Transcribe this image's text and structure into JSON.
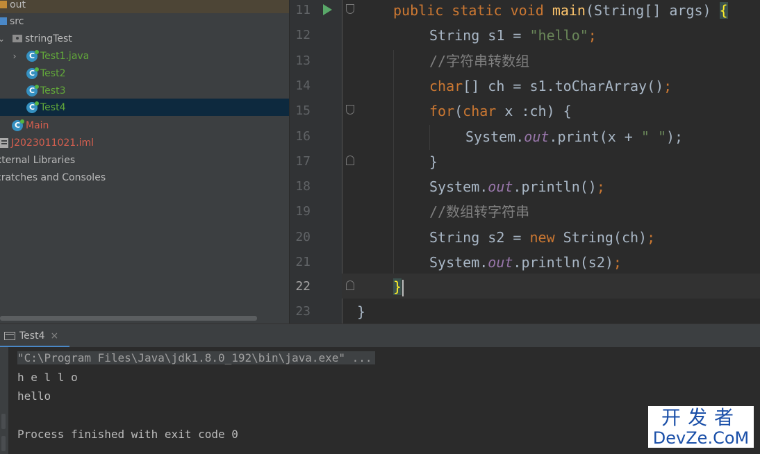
{
  "project_tree": {
    "items": [
      {
        "label": "out"
      },
      {
        "label": "src"
      },
      {
        "label": "stringTest"
      },
      {
        "label": "Test1.java"
      },
      {
        "label": "Test2"
      },
      {
        "label": "Test3"
      },
      {
        "label": "Test4"
      },
      {
        "label": "Main"
      },
      {
        "label": "J2023011021.iml"
      },
      {
        "label": "xternal Libraries"
      },
      {
        "label": "cratches and Consoles"
      }
    ]
  },
  "editor": {
    "lines": [
      {
        "num": "11"
      },
      {
        "num": "12"
      },
      {
        "num": "13"
      },
      {
        "num": "14"
      },
      {
        "num": "15"
      },
      {
        "num": "16"
      },
      {
        "num": "17"
      },
      {
        "num": "18"
      },
      {
        "num": "19"
      },
      {
        "num": "20"
      },
      {
        "num": "21"
      },
      {
        "num": "22"
      },
      {
        "num": "23"
      }
    ],
    "tokens": {
      "l11": [
        "public",
        "static",
        "void",
        "main",
        "(String[] args) ",
        "{"
      ],
      "l12": [
        "String s1 = ",
        "\"hello\"",
        ";"
      ],
      "l13": [
        "//字符串转数组"
      ],
      "l14": [
        "char",
        "[] ch = s1.toCharArray()",
        ";"
      ],
      "l15": [
        "for",
        "(",
        "char",
        " x :ch) {"
      ],
      "l16": [
        "System.",
        "out",
        ".print(x + ",
        "\" \"",
        ");"
      ],
      "l17": [
        "}"
      ],
      "l18": [
        "System.",
        "out",
        ".println()",
        ";"
      ],
      "l19": [
        "//数组转字符串"
      ],
      "l20": [
        "String s2 = ",
        "new",
        " String(ch)",
        ";"
      ],
      "l21": [
        "System.",
        "out",
        ".println(s2)",
        ";"
      ],
      "l22": [
        "}"
      ],
      "l23": [
        "}"
      ]
    }
  },
  "run_panel": {
    "tab_label": "Test4",
    "close_glyph": "×",
    "console": [
      "\"C:\\Program Files\\Java\\jdk1.8.0_192\\bin\\java.exe\" ...",
      "h e l l o",
      "hello",
      "Process finished with exit code 0"
    ]
  },
  "watermark": {
    "top": "开发者",
    "bottom": "DevZe.CoM"
  }
}
